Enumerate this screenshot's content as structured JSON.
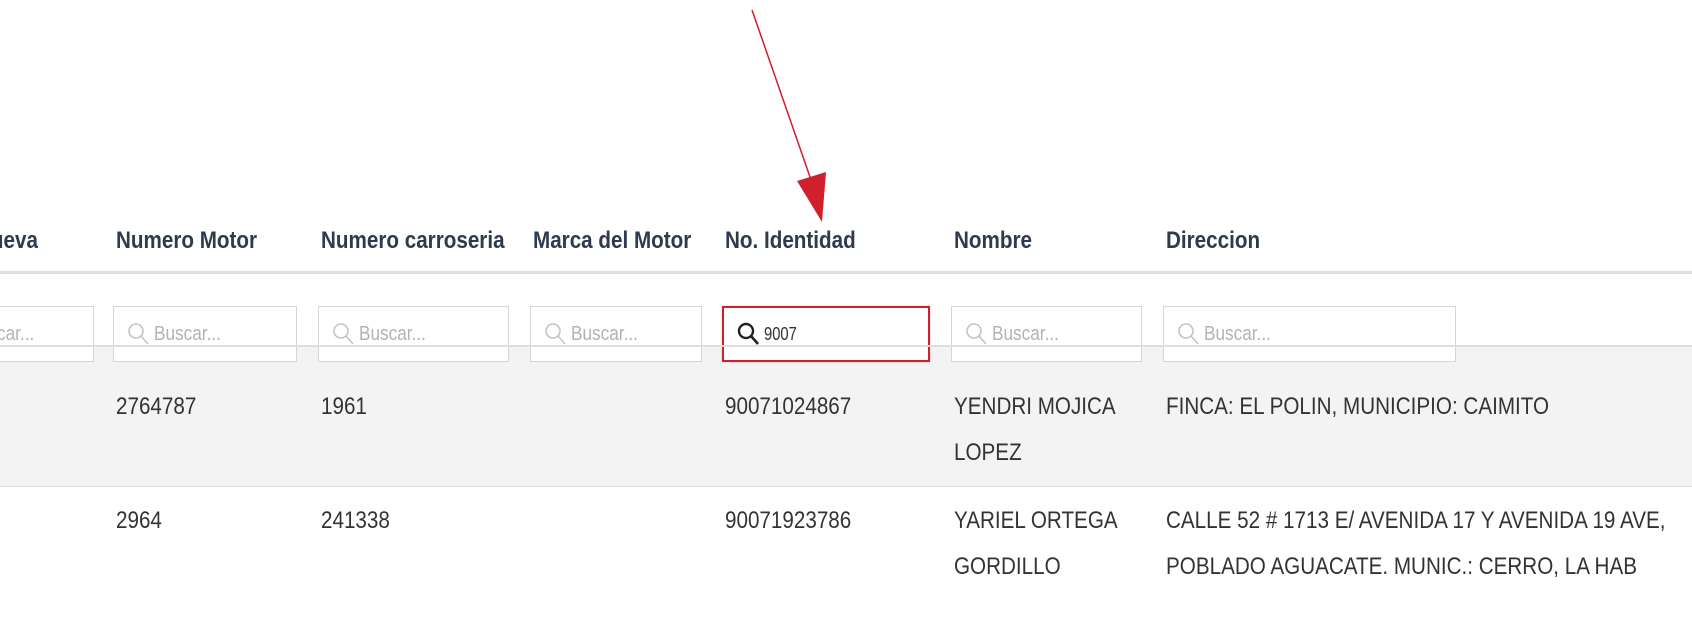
{
  "columns": [
    {
      "label": "Nueva"
    },
    {
      "label": "Numero Motor"
    },
    {
      "label": "Numero carroseria"
    },
    {
      "label": "Marca del Motor"
    },
    {
      "label": "No. Identidad"
    },
    {
      "label": "Nombre"
    },
    {
      "label": "Direccion"
    }
  ],
  "filters": {
    "placeholder_partial": "car...",
    "placeholder": "Buscar...",
    "identidad_value": "9007"
  },
  "rows": [
    {
      "numero_motor": "2764787",
      "numero_carroseria": "1961",
      "marca_motor": "",
      "identidad": "90071024867",
      "nombre_line1": "YENDRI MOJICA",
      "nombre_line2": "LOPEZ",
      "direccion_line1": "FINCA: EL POLIN, MUNICIPIO: CAIMITO",
      "direccion_line2": ""
    },
    {
      "numero_motor": "2964",
      "numero_carroseria": "241338",
      "marca_motor": "",
      "identidad": "90071923786",
      "nombre_line1": "YARIEL ORTEGA",
      "nombre_line2": "GORDILLO",
      "direccion_line1": "CALLE 52 # 1713 E/ AVENIDA 17 Y AVENIDA 19 AVE,",
      "direccion_line2": "POBLADO AGUACATE. MUNIC.: CERRO, LA HAB"
    }
  ],
  "colors": {
    "arrow": "#d0202e",
    "active_border": "#d0202e",
    "header_text": "#2e3b4e",
    "placeholder_text": "#b3b3b3",
    "row_stripe": "#f3f3f3"
  },
  "icons": {
    "search": "search-icon"
  }
}
